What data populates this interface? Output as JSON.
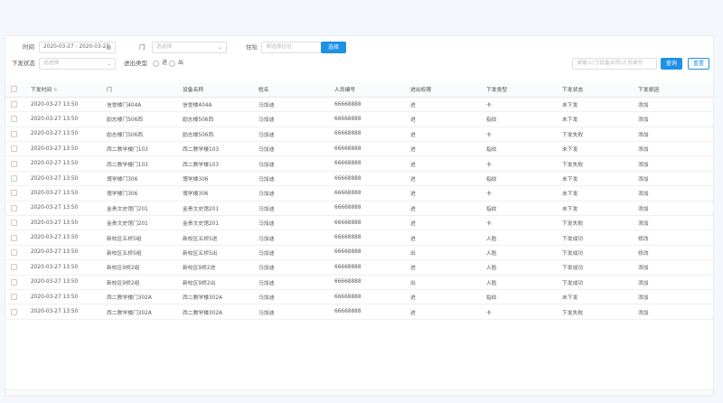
{
  "filters": {
    "time_label": "时间",
    "date_range": "2020-03-27 - 2020-03-27",
    "door_label": "门",
    "door_placeholder": "选选择",
    "address_label": "住址",
    "address_placeholder": "请选择住址",
    "select_button": "选择",
    "status_label": "下发状态",
    "status_placeholder": "选选择",
    "inout_label": "进出类型",
    "in_option": "进",
    "out_option": "出",
    "search_placeholder": "请输入门/设备名称/人员编号",
    "query_button": "查询",
    "reset_button": "重置"
  },
  "table": {
    "headers": [
      "下发时间",
      "门",
      "设备名称",
      "姓名",
      "人员编号",
      "进出权限",
      "下发类型",
      "下发状态",
      "下发原因"
    ],
    "rows": [
      [
        "2020-03-27 13:50",
        "信誉楼门404A",
        "信誉楼404A",
        "马加迪",
        "66668888",
        "进",
        "卡",
        "未下发",
        "添加"
      ],
      [
        "2020-03-27 13:50",
        "励志楼门506西",
        "励志楼506西",
        "马加迪",
        "66668888",
        "进",
        "指纹",
        "未下发",
        "添加"
      ],
      [
        "2020-03-27 13:50",
        "励志楼门506西",
        "励志楼506西",
        "马加迪",
        "66668888",
        "进",
        "卡",
        "下发失败",
        "添加"
      ],
      [
        "2020-03-27 13:50",
        "西二教学楼门103",
        "西二教学楼103",
        "马加迪",
        "66668888",
        "进",
        "指纹",
        "未下发",
        "添加"
      ],
      [
        "2020-03-27 13:50",
        "西二教学楼门103",
        "西二教学楼103",
        "马加迪",
        "66668888",
        "进",
        "卡",
        "下发失败",
        "添加"
      ],
      [
        "2020-03-27 13:50",
        "博学楼门306",
        "博学楼306",
        "马加迪",
        "66668888",
        "进",
        "指纹",
        "未下发",
        "添加"
      ],
      [
        "2020-03-27 13:50",
        "博学楼门306",
        "博学楼306",
        "马加迪",
        "66668888",
        "进",
        "卡",
        "未下发",
        "添加"
      ],
      [
        "2020-03-27 13:50",
        "金贵文史馆门201",
        "金贵文史馆201",
        "马加迪",
        "66668888",
        "进",
        "指纹",
        "未下发",
        "添加"
      ],
      [
        "2020-03-27 13:50",
        "金贵文史馆门201",
        "金贵文史馆201",
        "马加迪",
        "66668888",
        "进",
        "卡",
        "下发失败",
        "添加"
      ],
      [
        "2020-03-27 13:50",
        "新校区五桥5组",
        "新校区五桥5进",
        "马加迪",
        "66668888",
        "进",
        "人脸",
        "下发成功",
        "修改"
      ],
      [
        "2020-03-27 13:50",
        "新校区五桥5组",
        "新校区五桥5出",
        "马加迪",
        "66668888",
        "出",
        "人脸",
        "下发成功",
        "修改"
      ],
      [
        "2020-03-27 13:50",
        "新校区9桥2组",
        "新校区9桥2进",
        "马加迪",
        "66668888",
        "进",
        "人脸",
        "下发成功",
        "添加"
      ],
      [
        "2020-03-27 13:50",
        "新校区9桥2组",
        "新校区9桥2出",
        "马加迪",
        "66668888",
        "出",
        "人脸",
        "下发成功",
        "添加"
      ],
      [
        "2020-03-27 13:50",
        "西二教学楼门302A",
        "西二教学楼302A",
        "马加迪",
        "66668888",
        "进",
        "指纹",
        "未下发",
        "添加"
      ],
      [
        "2020-03-27 13:50",
        "西二教学楼门302A",
        "西二教学楼302A",
        "马加迪",
        "66668888",
        "进",
        "卡",
        "下发失败",
        "添加"
      ]
    ]
  }
}
